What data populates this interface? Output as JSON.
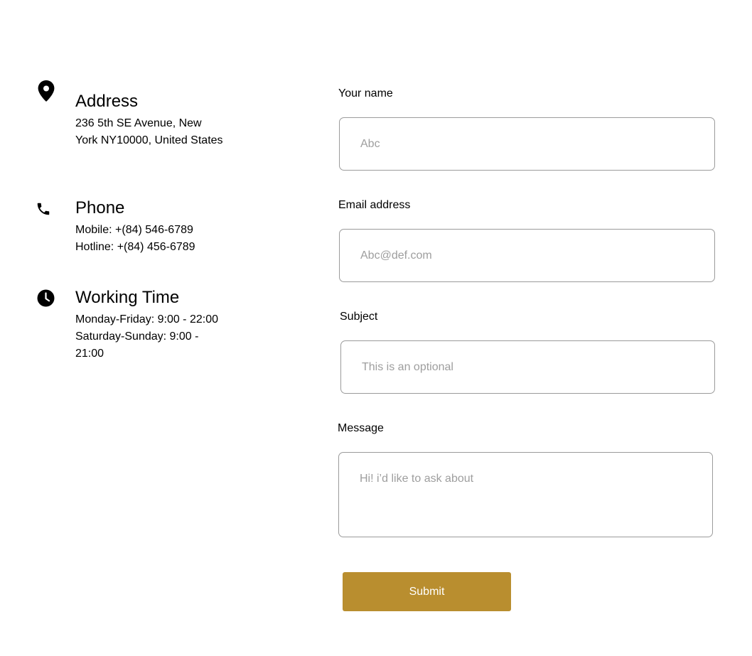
{
  "contact_info": {
    "address": {
      "icon": "location-pin-icon",
      "title": "Address",
      "lines": [
        "236 5th SE Avenue, New York NY10000, United States"
      ]
    },
    "phone": {
      "icon": "phone-icon",
      "title": "Phone",
      "lines": [
        "Mobile: +(84) 546-6789",
        "Hotline: +(84) 456-6789"
      ]
    },
    "working_time": {
      "icon": "clock-icon",
      "title": "Working Time",
      "lines": [
        "Monday-Friday: 9:00 - 22:00",
        "Saturday-Sunday: 9:00 - 21:00"
      ]
    }
  },
  "form": {
    "name": {
      "label": "Your name",
      "placeholder": "Abc",
      "value": ""
    },
    "email": {
      "label": "Email address",
      "placeholder": "Abc@def.com",
      "value": ""
    },
    "subject": {
      "label": "Subject",
      "placeholder": "This is an optional",
      "value": ""
    },
    "message": {
      "label": "Message",
      "placeholder": "Hi! i’d like to ask about",
      "value": ""
    },
    "submit_label": "Submit"
  },
  "colors": {
    "accent": "#b98e2f",
    "text": "#000000",
    "placeholder": "#9e9e9e",
    "border": "#9b9b9b"
  }
}
